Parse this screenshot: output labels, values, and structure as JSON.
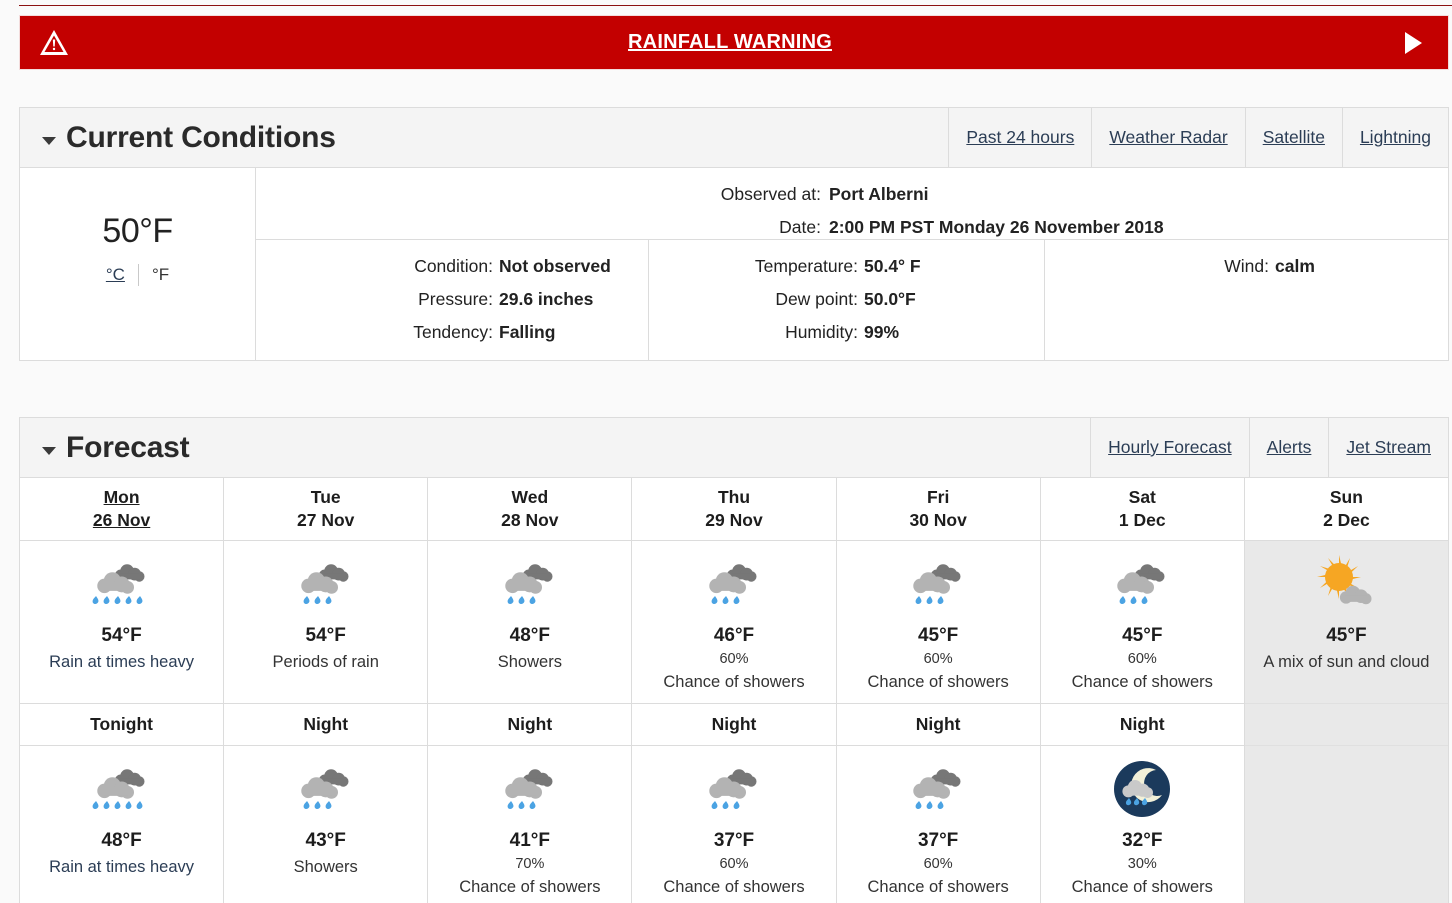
{
  "alert": {
    "title": "RAINFALL WARNING",
    "icon": "warning-triangle-icon",
    "next_icon": "play-arrow-icon",
    "color": "#c30000"
  },
  "current_conditions": {
    "heading": "Current Conditions",
    "links": [
      "Past 24 hours",
      "Weather Radar",
      "Satellite",
      "Lightning"
    ],
    "temperature_display": "50°F",
    "unit_celsius": "°C",
    "unit_fahrenheit": "°F",
    "observed_at_label": "Observed at:",
    "observed_at_value": "Port Alberni",
    "date_label": "Date:",
    "date_value": "2:00 PM PST Monday 26 November 2018",
    "details": [
      {
        "rows": [
          {
            "key": "Condition:",
            "value": "Not observed"
          },
          {
            "key": "Pressure:",
            "value": "29.6 inches"
          },
          {
            "key": "Tendency:",
            "value": "Falling"
          }
        ]
      },
      {
        "rows": [
          {
            "key": "Temperature:",
            "value": "50.4° F"
          },
          {
            "key": "Dew point:",
            "value": "50.0°F"
          },
          {
            "key": "Humidity:",
            "value": "99%"
          }
        ]
      },
      {
        "rows": [
          {
            "key": "Wind:",
            "value": "calm"
          }
        ]
      }
    ]
  },
  "forecast": {
    "heading": "Forecast",
    "links": [
      "Hourly Forecast",
      "Alerts",
      "Jet Stream"
    ],
    "days": [
      {
        "weekday": "Mon",
        "date": "26 Nov",
        "today": true,
        "day": {
          "icon": "rain-heavy-icon",
          "temp": "54°F",
          "pop": "",
          "desc": "Rain at times heavy",
          "desc_is_link": true
        },
        "night_label": "Tonight",
        "night": {
          "icon": "rain-heavy-icon",
          "temp": "48°F",
          "pop": "",
          "desc": "Rain at times heavy",
          "desc_is_link": true
        }
      },
      {
        "weekday": "Tue",
        "date": "27 Nov",
        "today": false,
        "day": {
          "icon": "rain-icon",
          "temp": "54°F",
          "pop": "",
          "desc": "Periods of rain",
          "desc_is_link": false
        },
        "night_label": "Night",
        "night": {
          "icon": "rain-icon",
          "temp": "43°F",
          "pop": "",
          "desc": "Showers",
          "desc_is_link": false
        }
      },
      {
        "weekday": "Wed",
        "date": "28 Nov",
        "today": false,
        "day": {
          "icon": "rain-icon",
          "temp": "48°F",
          "pop": "",
          "desc": "Showers",
          "desc_is_link": false
        },
        "night_label": "Night",
        "night": {
          "icon": "rain-icon",
          "temp": "41°F",
          "pop": "70%",
          "desc": "Chance of showers",
          "desc_is_link": false
        }
      },
      {
        "weekday": "Thu",
        "date": "29 Nov",
        "today": false,
        "day": {
          "icon": "rain-icon",
          "temp": "46°F",
          "pop": "60%",
          "desc": "Chance of showers",
          "desc_is_link": false
        },
        "night_label": "Night",
        "night": {
          "icon": "rain-icon",
          "temp": "37°F",
          "pop": "60%",
          "desc": "Chance of showers",
          "desc_is_link": false
        }
      },
      {
        "weekday": "Fri",
        "date": "30 Nov",
        "today": false,
        "day": {
          "icon": "rain-icon",
          "temp": "45°F",
          "pop": "60%",
          "desc": "Chance of showers",
          "desc_is_link": false
        },
        "night_label": "Night",
        "night": {
          "icon": "rain-icon",
          "temp": "37°F",
          "pop": "60%",
          "desc": "Chance of showers",
          "desc_is_link": false
        }
      },
      {
        "weekday": "Sat",
        "date": "1 Dec",
        "today": false,
        "day": {
          "icon": "rain-icon",
          "temp": "45°F",
          "pop": "60%",
          "desc": "Chance of showers",
          "desc_is_link": false
        },
        "night_label": "Night",
        "night": {
          "icon": "night-rain-icon",
          "temp": "32°F",
          "pop": "30%",
          "desc": "Chance of showers",
          "desc_is_link": false
        }
      },
      {
        "weekday": "Sun",
        "date": "2 Dec",
        "today": false,
        "day": {
          "icon": "sun-cloud-icon",
          "temp": "45°F",
          "pop": "",
          "desc": "A mix of sun and cloud",
          "desc_is_link": false
        },
        "night_label": "",
        "night": null
      }
    ]
  },
  "colors": {
    "alert_red": "#c30000",
    "link_blue": "#2b3d55",
    "cloud_light": "#b3b3b3",
    "cloud_dark": "#777777",
    "raindrop": "#4ba3e3",
    "sun": "#f6a623",
    "night_circle": "#1b3a5c"
  }
}
